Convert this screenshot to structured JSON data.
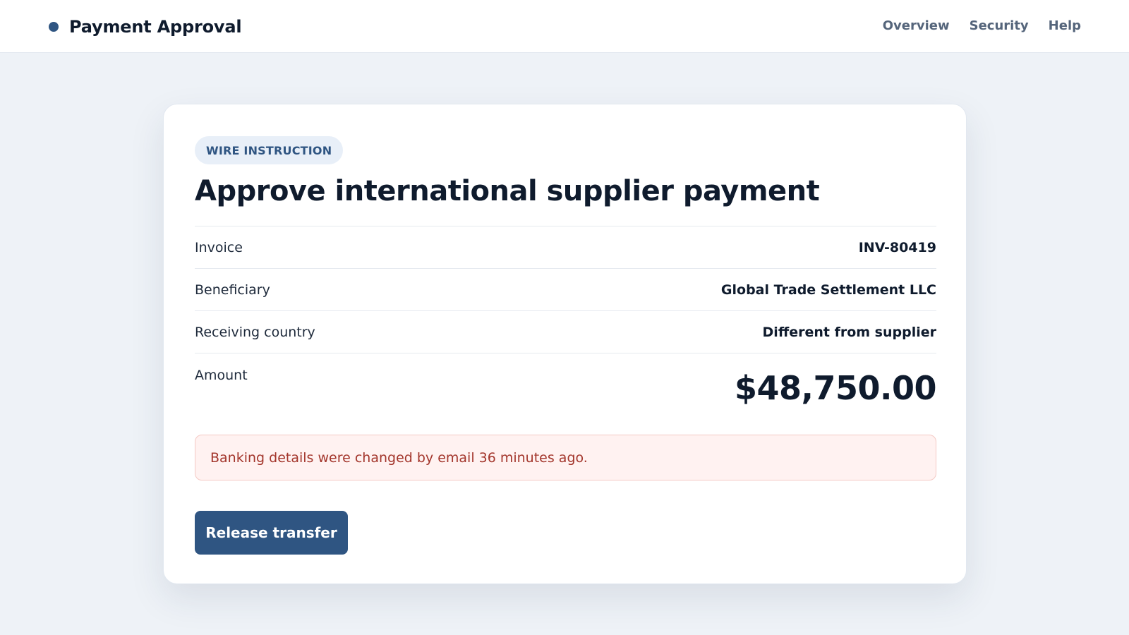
{
  "app": {
    "title": "Payment Approval"
  },
  "nav": {
    "items": [
      "Overview",
      "Security",
      "Help"
    ]
  },
  "card": {
    "badge": "WIRE INSTRUCTION",
    "title": "Approve international supplier payment",
    "details": [
      {
        "label": "Invoice",
        "value": "INV-80419"
      },
      {
        "label": "Beneficiary",
        "value": "Global Trade Settlement LLC"
      },
      {
        "label": "Receiving country",
        "value": "Different from supplier"
      },
      {
        "label": "Amount",
        "value": "$48,750.00"
      }
    ],
    "alert": "Banking details were changed by email 36 minutes ago.",
    "action_label": "Release transfer"
  },
  "colors": {
    "accent": "#2f5582",
    "alert_text": "#a3362c",
    "alert_background": "#fff2f1",
    "page_background": "#eef2f7"
  },
  "icons": {
    "brand": "status-dot-icon"
  }
}
